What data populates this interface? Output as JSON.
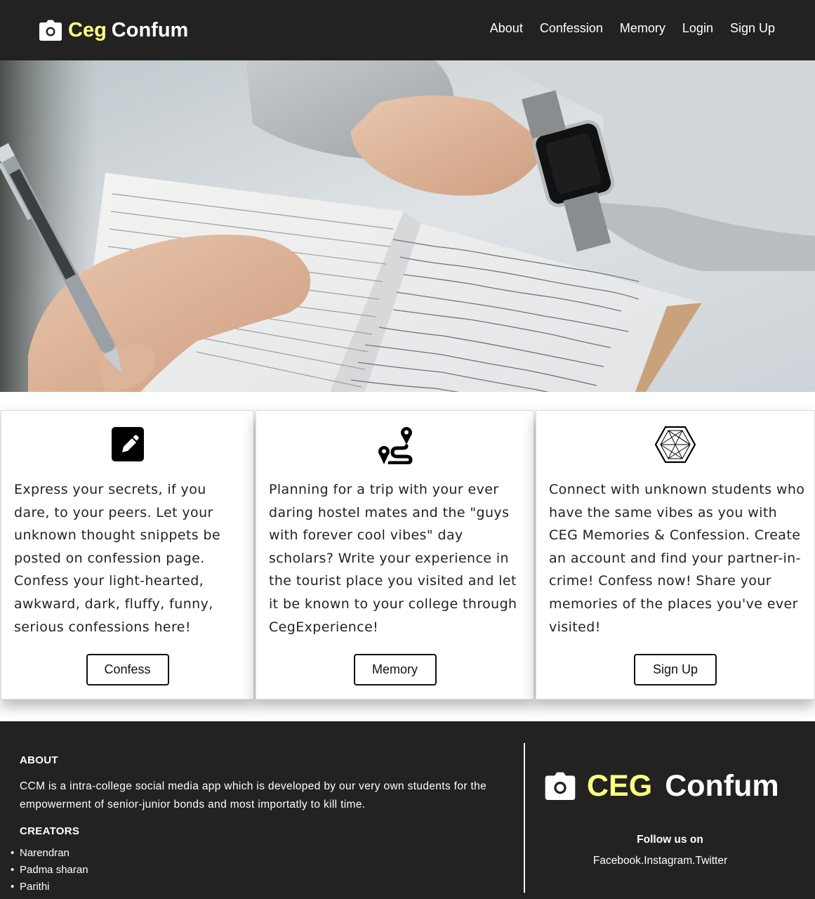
{
  "navbar": {
    "brand_part1": "Ceg",
    "brand_part2": "Confum",
    "links": [
      "About",
      "Confession",
      "Memory",
      "Login",
      "Sign Up"
    ]
  },
  "hero": {
    "image": "person-writing-in-notebook-with-pen-and-wristwatch"
  },
  "cards": [
    {
      "icon": "edit-icon",
      "text": "Express your secrets, if you dare, to your peers. Let your unknown thought snippets be posted on confession page. Confess your light-hearted, awkward, dark, fluffy, funny, serious confessions here!",
      "button": "Confess"
    },
    {
      "icon": "route-icon",
      "text": "Planning for a trip with your ever daring hostel mates and the \"guys with forever cool vibes\" day scholars? Write your experience in the tourist place you visited and let it be known to your college through CegExperience!",
      "button": "Memory"
    },
    {
      "icon": "network-icon",
      "text": "Connect with unknown students who have the same vibes as you with CEG Memories & Confession. Create an account and find your partner-in-crime! Confess now! Share your memories of the places you've ever visited!",
      "button": "Sign Up"
    }
  ],
  "footer": {
    "about_heading": "ABOUT",
    "about_text": "CCM is a intra-college social media app which is developed by our very own students for the empowerment of senior-junior bonds and most importatly to kill time.",
    "creators_heading": "CREATORS",
    "creators": [
      "Narendran",
      "Padma sharan",
      "Parithi"
    ],
    "brand_part1": "CEG",
    "brand_part2": "Confum",
    "follow_heading": "Follow us on",
    "social": [
      "Facebook",
      "Instagram",
      "Twitter"
    ],
    "social_separator": "."
  },
  "colors": {
    "dark_bg": "#222222",
    "brand_yellow": "#ffff80",
    "white": "#ffffff"
  }
}
